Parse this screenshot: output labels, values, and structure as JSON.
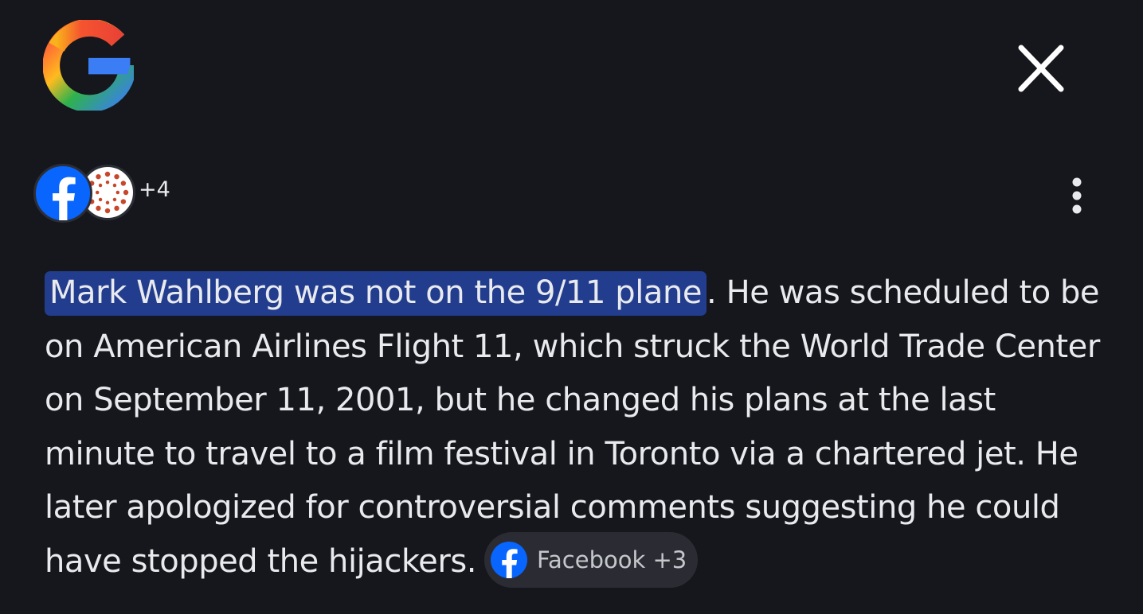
{
  "header": {
    "logo_icon": "google-g-icon",
    "close_icon": "close-icon"
  },
  "sources": {
    "icons": [
      "facebook-icon",
      "dotted-circle-logo-icon"
    ],
    "more_count": "+4",
    "menu_icon": "more-vert-icon"
  },
  "answer": {
    "highlight": "Mark Wahlberg was not on the 9/11 plane",
    "body": ". He was scheduled to be on American Airlines Flight 11, which struck the World Trade Center on September 11, 2001, but he changed his plans at the last minute to travel to a film festival in Toronto via a chartered jet. He later apologized for controversial comments suggesting he could have stopped the hijackers.",
    "citation": {
      "icon": "facebook-icon",
      "label": "Facebook +3"
    }
  },
  "colors": {
    "background": "#16171c",
    "highlight": "#233d8e",
    "chip": "#2b2c33",
    "facebook_blue": "#0866ff"
  }
}
